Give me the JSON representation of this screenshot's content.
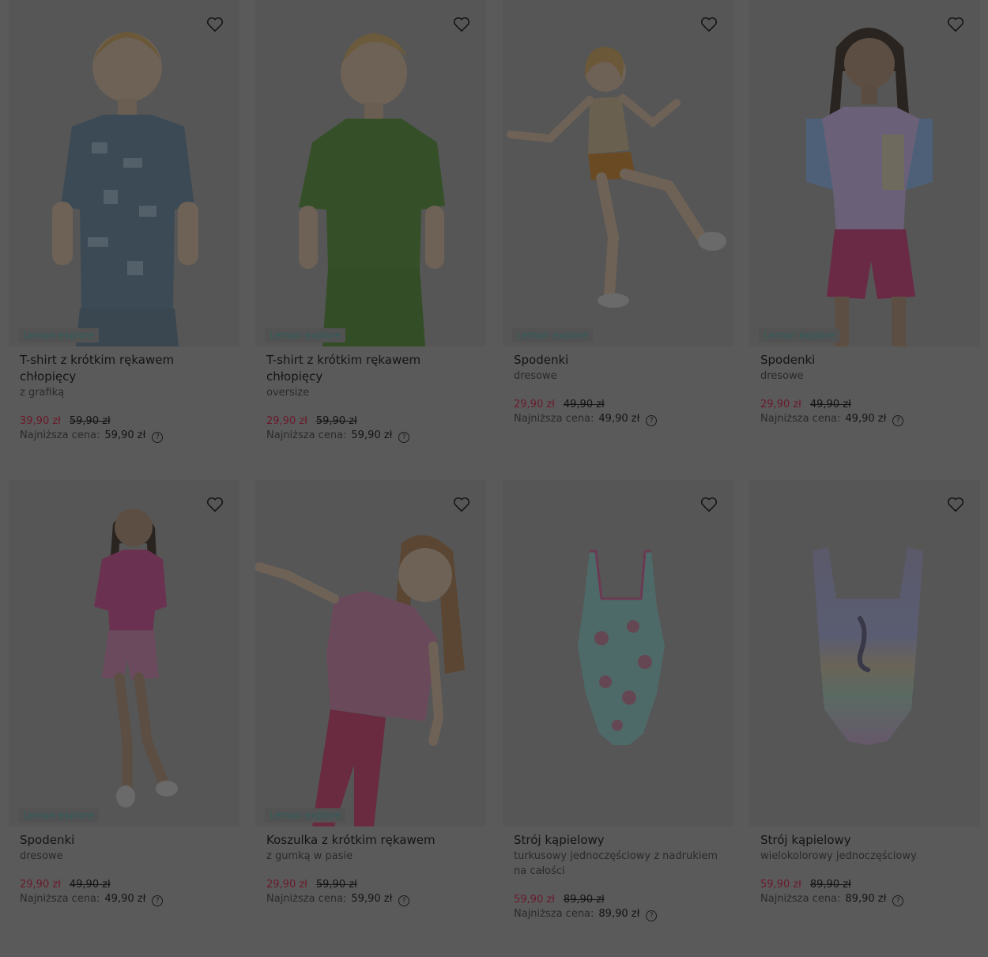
{
  "products": [
    {
      "brand": "Lemon explore",
      "name": "T-shirt z krótkim rękawem chłopięcy",
      "sub": "z grafiką",
      "price": "39,90 zł",
      "old_price": "59,90 zł",
      "lowest_label": "Najniższa cena:",
      "lowest_value": "59,90 zł",
      "image": "boy-printed-tshirt"
    },
    {
      "brand": "Lemon explore",
      "name": "T-shirt z krótkim rękawem chłopięcy",
      "sub": "oversize",
      "price": "29,90 zł",
      "old_price": "59,90 zł",
      "lowest_label": "Najniższa cena:",
      "lowest_value": "59,90 zł",
      "image": "boy-green-tshirt"
    },
    {
      "brand": "Lemon explore",
      "name": "Spodenki",
      "sub": "dresowe",
      "price": "29,90 zł",
      "old_price": "49,90 zł",
      "lowest_label": "Najniższa cena:",
      "lowest_value": "49,90 zł",
      "image": "girl-orange-shorts"
    },
    {
      "brand": "Lemon explore",
      "name": "Spodenki",
      "sub": "dresowe",
      "price": "29,90 zł",
      "old_price": "49,90 zł",
      "lowest_label": "Najniższa cena:",
      "lowest_value": "49,90 zł",
      "image": "girl-pink-shorts"
    },
    {
      "brand": "Lemon explore",
      "name": "Spodenki",
      "sub": "dresowe",
      "price": "29,90 zł",
      "old_price": "49,90 zł",
      "lowest_label": "Najniższa cena:",
      "lowest_value": "49,90 zł",
      "image": "girl-striped-shorts"
    },
    {
      "brand": "Lemon explore",
      "name": "Koszulka z krótkim rękawem",
      "sub": "z gumką w pasie",
      "price": "29,90 zł",
      "old_price": "59,90 zł",
      "lowest_label": "Najniższa cena:",
      "lowest_value": "59,90 zł",
      "image": "girl-striped-tshirt"
    },
    {
      "brand": "",
      "name": "Strój kąpielowy",
      "sub": "turkusowy jednoczęściowy z nadrukiem na całości",
      "price": "59,90 zł",
      "old_price": "89,90 zł",
      "lowest_label": "Najniższa cena:",
      "lowest_value": "89,90 zł",
      "image": "turquoise-swimsuit"
    },
    {
      "brand": "",
      "name": "Strój kąpielowy",
      "sub": "wielokolorowy jednoczęściowy",
      "price": "59,90 zł",
      "old_price": "89,90 zł",
      "lowest_label": "Najniższa cena:",
      "lowest_value": "89,90 zł",
      "image": "rainbow-swimsuit"
    }
  ],
  "icons": {
    "wishlist": "heart-outline-icon",
    "help": "question-circle-icon"
  },
  "colors": {
    "overlay": "#5a5a5a",
    "sale_price": "#6a1a2c",
    "brand_text": "#2f5d5a"
  }
}
